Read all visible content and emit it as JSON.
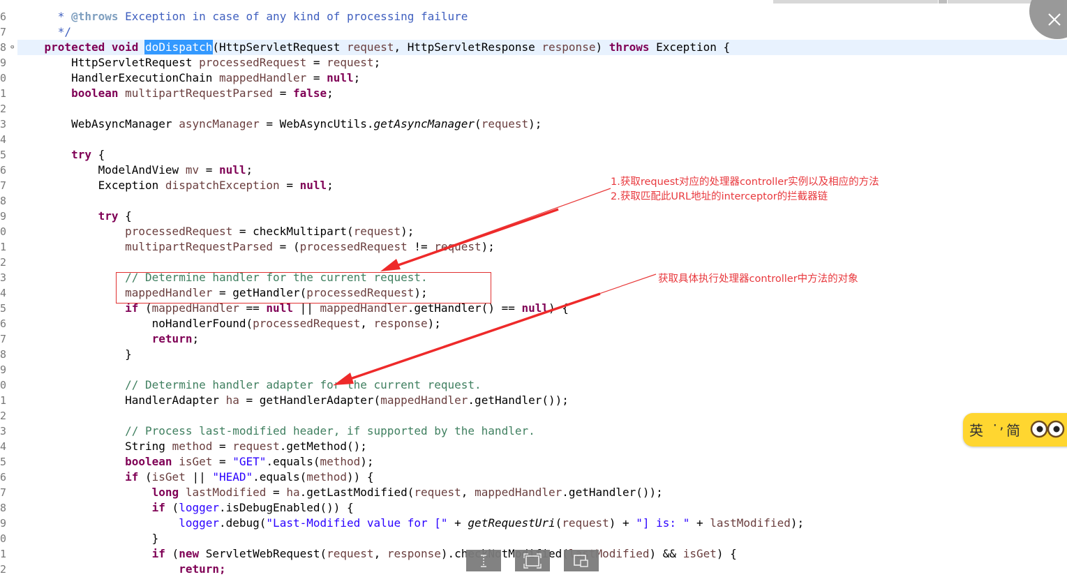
{
  "editor": {
    "gutter_numbers": [
      "6",
      "7",
      "8",
      "9",
      "0",
      "1",
      "2",
      "3",
      "4",
      "5",
      "6",
      "7",
      "8",
      "9",
      "0",
      "1",
      "2",
      "3",
      "4",
      "5",
      "6",
      "7",
      "8",
      "9",
      "0",
      "1",
      "2",
      "3",
      "4",
      "5",
      "6",
      "7",
      "8",
      "9",
      "0",
      "1",
      "2"
    ],
    "fold_marker": "⊖",
    "tokens": {
      "t_throws_doc_1": "* ",
      "t_throws_doc_2": "@throws",
      "t_throws_doc_3": " Exception in case of any kind of processing failure",
      "t_doc_end": "*/",
      "t_protected": "protected",
      "t_void": "void",
      "t_method_name": "doDispatch",
      "t_sig_1": "(HttpServletRequest ",
      "t_request": "request",
      "t_sig_2": ", HttpServletResponse ",
      "t_response": "response",
      "t_sig_3": ") ",
      "t_throws": "throws",
      "t_sig_4": " Exception {",
      "t_l9_1": "HttpServletRequest ",
      "t_l9_2": "processedRequest",
      "t_l9_3": " = ",
      "t_l9_4": "request",
      "t_l9_5": ";",
      "t_l10_1": "HandlerExecutionChain ",
      "t_l10_2": "mappedHandler",
      "t_l10_3": " = ",
      "t_null": "null",
      "t_semi": ";",
      "t_boolean": "boolean",
      "t_l11_2": " multipartRequestParsed",
      "t_l11_3": " = ",
      "t_false": "false",
      "t_l13_1": "WebAsyncManager ",
      "t_l13_2": "asyncManager",
      "t_l13_3": " = WebAsyncUtils.",
      "t_l13_4": "getAsyncManager",
      "t_l13_5": "(",
      "t_l13_6": "request",
      "t_l13_7": ");",
      "t_try": "try",
      "t_brace_open": " {",
      "t_l16_1": "ModelAndView ",
      "t_l16_2": "mv",
      "t_l16_3": " = ",
      "t_l17_1": "Exception ",
      "t_l17_2": "dispatchException",
      "t_l17_3": " = ",
      "t_l20_1": "processedRequest",
      "t_l20_2": " = checkMultipart(",
      "t_l20_3": "request",
      "t_l20_4": ");",
      "t_l21_1": "multipartRequestParsed",
      "t_l21_2": " = (",
      "t_l21_3": "processedRequest",
      "t_l21_4": " != ",
      "t_l21_5": "request",
      "t_l21_6": ");",
      "t_l23": "// Determine handler for the current request.",
      "t_l24_1": "mappedHandler",
      "t_l24_2": " = getHandler(",
      "t_l24_3": "processedRequest",
      "t_l24_4": ");",
      "t_if": "if",
      "t_l25_1": " (",
      "t_l25_2": "mappedHandler",
      "t_l25_3": " == ",
      "t_l25_4": " || ",
      "t_l25_5": "mappedHandler",
      "t_l25_6": ".getHandler() == ",
      "t_l25_7": ") {",
      "t_l26_1": "noHandlerFound(",
      "t_l26_2": "processedRequest",
      "t_l26_3": ", ",
      "t_l26_4": "response",
      "t_l26_5": ");",
      "t_return": "return",
      "t_brace_close": "}",
      "t_l30": "// Determine handler adapter for the current request.",
      "t_l31_1": "HandlerAdapter ",
      "t_l31_2": "ha",
      "t_l31_3": " = getHandlerAdapter(",
      "t_l31_4": "mappedHandler",
      "t_l31_5": ".getHandler());",
      "t_l33": "// Process last-modified header, if supported by the handler.",
      "t_l34_1": "String ",
      "t_l34_2": "method",
      "t_l34_3": " = ",
      "t_l34_4": "request",
      "t_l34_5": ".getMethod();",
      "t_l35_2": " isGet",
      "t_l35_3": " = ",
      "t_get_str": "\"GET\"",
      "t_l35_4": ".equals(",
      "t_l35_5": "method",
      "t_l35_6": ");",
      "t_l36_1": " (",
      "t_l36_2": "isGet",
      "t_l36_3": " || ",
      "t_head_str": "\"HEAD\"",
      "t_l36_4": ".equals(",
      "t_l36_5": "method",
      "t_l36_6": ")) {",
      "t_long": "long",
      "t_l37_2": " lastModified",
      "t_l37_3": " = ",
      "t_l37_4": "ha",
      "t_l37_5": ".getLastModified(",
      "t_l37_6": "request",
      "t_l37_7": ", ",
      "t_l37_8": "mappedHandler",
      "t_l37_9": ".getHandler());",
      "t_l38_1": " (",
      "t_l38_2": "logger",
      "t_l38_3": ".isDebugEnabled()) {",
      "t_l39_1": "logger",
      "t_l39_2": ".debug(",
      "t_l39_3": "\"Last-Modified value for [\"",
      "t_l39_4": " + ",
      "t_l39_5": "getRequestUri",
      "t_l39_6": "(",
      "t_l39_7": "request",
      "t_l39_8": ") + ",
      "t_l39_9": "\"] is: \"",
      "t_l39_10": " + ",
      "t_l39_11": "lastModified",
      "t_l39_12": ");",
      "t_l41_1": " (",
      "t_new": "new",
      "t_l41_2": " ServletWebRequest(",
      "t_l41_3": "request",
      "t_l41_4": ", ",
      "t_l41_5": "response",
      "t_l41_6": ").checkNotModified(",
      "t_l41_7": "lastModified",
      "t_l41_8": ") && ",
      "t_l41_9": "isGet",
      "t_l41_10": ") {",
      "t_l42": "return;"
    }
  },
  "annotations": {
    "note1_line1": "1.获取request对应的处理器controller实例以及相应的方法",
    "note1_line2": "2.获取匹配此URL地址的interceptor的拦截器链",
    "note2": "获取具体执行处理器controller中方法的对象"
  },
  "ime_widget": {
    "mode_en": "英",
    "separator": "·,",
    "mode_sc": "简"
  },
  "colors": {
    "keyword": "#7f0055",
    "comment": "#3f7f5f",
    "javadoc": "#3f5fbf",
    "string": "#2a00ff",
    "annotation_red": "#e8383d",
    "selection": "#3399ff",
    "current_line": "#e8f2fe",
    "ime_yellow": "#ffd630"
  }
}
